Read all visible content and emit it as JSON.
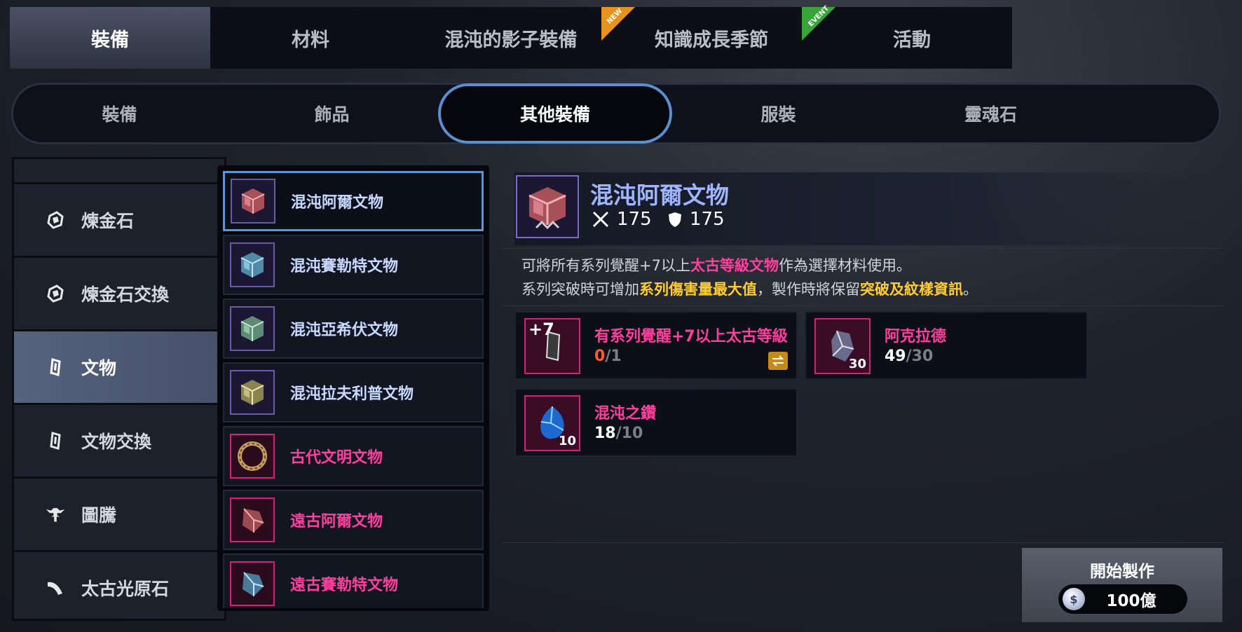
{
  "top_tabs": [
    {
      "label": "裝備",
      "active": true
    },
    {
      "label": "材料"
    },
    {
      "label": "混沌的影子裝備"
    },
    {
      "label": "知識成長季節",
      "ribbon": "NEW"
    },
    {
      "label": "活動",
      "ribbon": "EVENT"
    }
  ],
  "sub_tabs": [
    {
      "label": "裝備"
    },
    {
      "label": "飾品"
    },
    {
      "label": "其他裝備",
      "active": true
    },
    {
      "label": "服裝"
    },
    {
      "label": "靈魂石"
    }
  ],
  "categories": [
    {
      "label": "煉金石",
      "icon": "alchemy-stone-icon"
    },
    {
      "label": "煉金石交換",
      "icon": "alchemy-stone-exchange-icon"
    },
    {
      "label": "文物",
      "icon": "artifact-icon",
      "active": true
    },
    {
      "label": "文物交換",
      "icon": "artifact-exchange-icon"
    },
    {
      "label": "圖騰",
      "icon": "totem-icon"
    },
    {
      "label": "太古光原石",
      "icon": "primeval-light-stone-icon"
    }
  ],
  "items": [
    {
      "name": "混沌阿爾文物",
      "selected": true
    },
    {
      "name": "混沌賽勒特文物"
    },
    {
      "name": "混沌亞希伏文物"
    },
    {
      "name": "混沌拉夫利普文物"
    },
    {
      "name": "古代文明文物"
    },
    {
      "name": "遠古阿爾文物"
    },
    {
      "name": "遠古賽勒特文物"
    }
  ],
  "detail": {
    "title": "混沌阿爾文物",
    "attack": "175",
    "defense": "175",
    "desc_line1_a": "可將所有系列覺醒+7以上",
    "desc_line1_hl": "太古等級文物",
    "desc_line1_b": "作為選擇材料使用。",
    "desc_line2_a": "系列突破時可增加",
    "desc_line2_hl1": "系列傷害量最大值",
    "desc_line2_b": "，製作時將保留",
    "desc_line2_hl2": "突破及紋樣資訊",
    "desc_line2_c": "。"
  },
  "materials": [
    {
      "name": "有系列覺醒+7以上太古等級",
      "have": "0",
      "need": "/1",
      "badge": "+7"
    },
    {
      "name": "阿克拉德",
      "have": "49",
      "need": "/30",
      "badge": "30"
    },
    {
      "name": "混沌之鑽",
      "have": "18",
      "need": "/10",
      "badge": "10"
    }
  ],
  "craft": {
    "label": "開始製作",
    "cost": "100億"
  },
  "colors": {
    "accent_blue": "#5e93d6",
    "rare_pink": "#ff3f9e",
    "highlight_gold": "#ffcc33"
  }
}
